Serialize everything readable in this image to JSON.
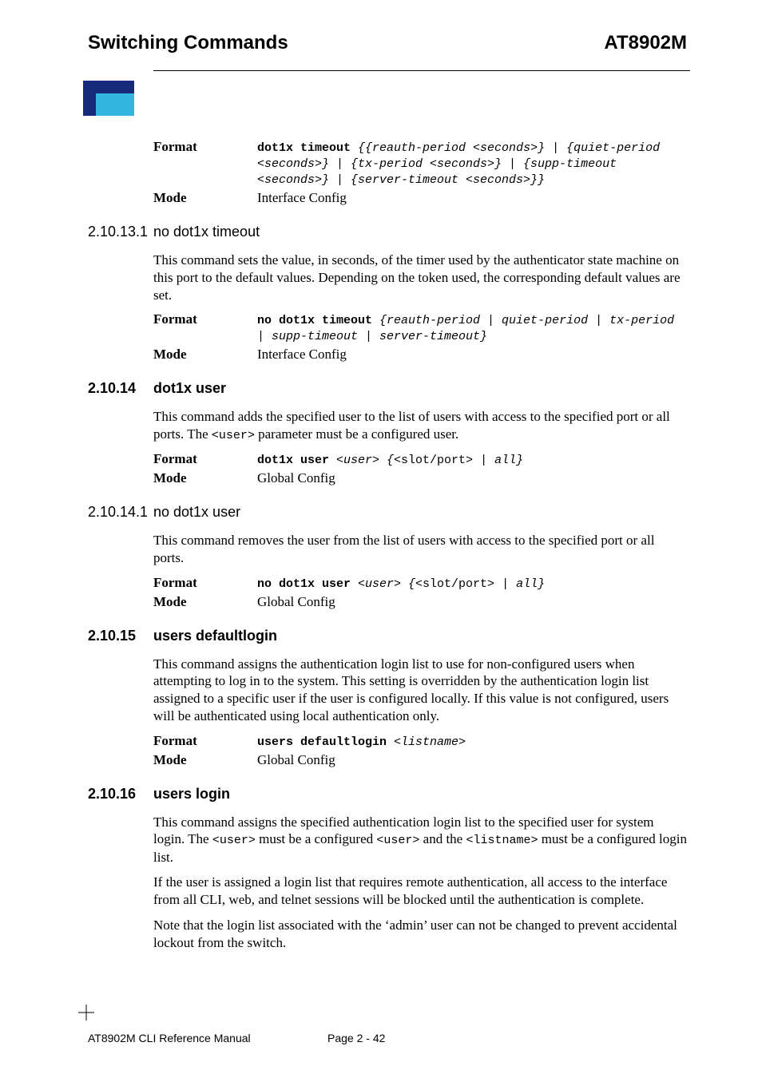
{
  "header": {
    "left": "Switching Commands",
    "right": "AT8902M"
  },
  "intro_block": {
    "fmt_label": "Format",
    "fmt_cmd": "dot1x timeout ",
    "fmt_args": "{{reauth-period <seconds>} | {quiet-period <seconds>} | {tx-period <seconds>} | {supp-timeout <seconds>} | {server-timeout <seconds>}}",
    "mode_label": "Mode",
    "mode_val": "Interface Config"
  },
  "s_2_10_13_1": {
    "num": "2.10.13.1",
    "title": "no dot1x timeout",
    "para": "This command sets the value, in seconds, of the timer used by the authenticator state machine on this port to the default values. Depending on the token used, the corresponding default values are set.",
    "fmt_label": "Format",
    "fmt_cmd": "no dot1x timeout ",
    "fmt_args": "{reauth-period | quiet-period | tx-period | supp-timeout | server-timeout}",
    "mode_label": "Mode",
    "mode_val": "Interface Config"
  },
  "s_2_10_14": {
    "num": "2.10.14",
    "title": "dot1x user",
    "para_pre": "This command adds the specified user to the list of users with access to the specified port or all ports. The ",
    "para_code": "<user>",
    "para_post": " parameter must be a configured user.",
    "fmt_label": "Format",
    "fmt_cmd": "dot1x user ",
    "fmt_arg1": "<user> {",
    "fmt_lit": "<slot/port>",
    "fmt_arg2": " | all}",
    "mode_label": "Mode",
    "mode_val": "Global Config"
  },
  "s_2_10_14_1": {
    "num": "2.10.14.1",
    "title": "no dot1x user",
    "para": "This command removes the user from the list of users with access to the specified port or all ports.",
    "fmt_label": "Format",
    "fmt_cmd": "no dot1x user ",
    "fmt_arg1": "<user> {",
    "fmt_lit": "<slot/port>",
    "fmt_arg2": " | all}",
    "mode_label": "Mode",
    "mode_val": "Global Config"
  },
  "s_2_10_15": {
    "num": "2.10.15",
    "title": "users defaultlogin",
    "para": "This command assigns the authentication login list to use for non-configured users when attempting to log in to the system. This setting is overridden by the authentication login list assigned to a specific user if the user is configured locally. If this value is not configured, users will be authenticated using local authentication only.",
    "fmt_label": "Format",
    "fmt_cmd": "users defaultlogin ",
    "fmt_args": "<listname>",
    "mode_label": "Mode",
    "mode_val": "Global Config"
  },
  "s_2_10_16": {
    "num": "2.10.16",
    "title": "users login",
    "p1_a": "This command assigns the specified authentication login list to the specified user for system login. The ",
    "p1_c1": "<user>",
    "p1_b": " must be a configured ",
    "p1_c2": "<user>",
    "p1_c": " and the ",
    "p1_c3": "<listname>",
    "p1_d": " must be a configured login list.",
    "p2": "If the user is assigned a login list that requires remote authentication, all access to the interface from all CLI, web, and telnet sessions will be blocked until the authentication is complete.",
    "p3": "Note that the login list associated with the ‘admin’ user can not be changed to prevent accidental lockout from the switch."
  },
  "footer": {
    "left": "AT8902M CLI Reference Manual",
    "mid": "Page 2 - 42"
  }
}
